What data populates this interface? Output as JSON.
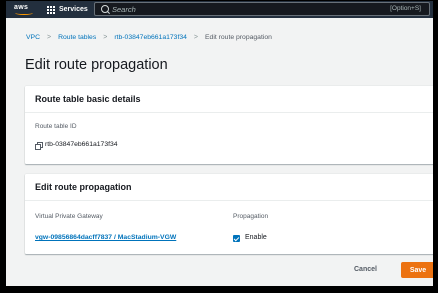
{
  "topbar": {
    "services_label": "Services",
    "search_placeholder": "Search",
    "search_shortcut": "[Option+S]"
  },
  "breadcrumb": {
    "items": [
      "VPC",
      "Route tables",
      "rtb-03847eb661a173f34",
      "Edit route propagation"
    ]
  },
  "page": {
    "title": "Edit route propagation"
  },
  "basic_details": {
    "heading": "Route table basic details",
    "id_label": "Route table ID",
    "id_value": "rtb-03847eb661a173f34"
  },
  "propagation": {
    "heading": "Edit route propagation",
    "col_gateway": "Virtual Private Gateway",
    "col_propagation": "Propagation",
    "gateway_value": "vgw-09856864dacff7837 / MacStadium-VGW",
    "enable_label": "Enable",
    "enabled": true
  },
  "footer": {
    "cancel_label": "Cancel",
    "save_label": "Save"
  },
  "colors": {
    "topbar": "#232f3e",
    "link": "#0073bb",
    "primary_button": "#ec7211",
    "background": "#f2f3f3"
  }
}
